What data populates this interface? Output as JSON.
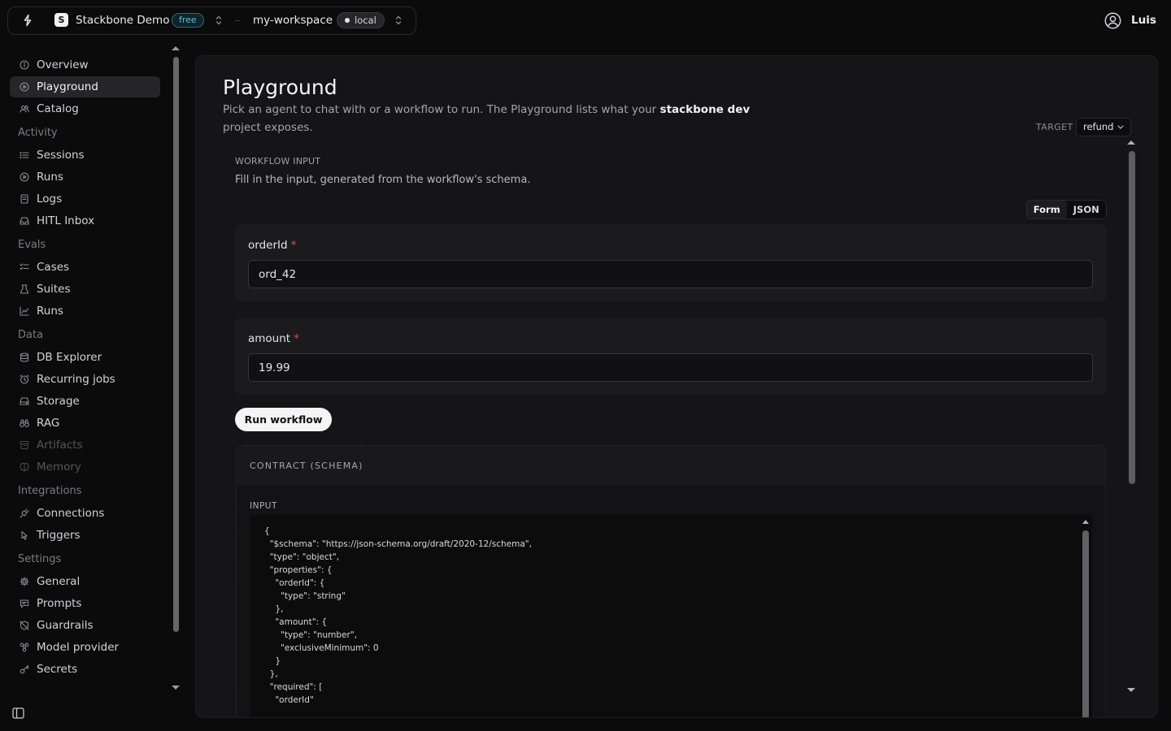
{
  "topbar": {
    "project_initial": "S",
    "project_name": "Stackbone Demo",
    "plan_badge": "free",
    "workspace_name": "my-workspace",
    "env_badge": "local",
    "user_name": "Luis"
  },
  "sidebar": {
    "top_items": [
      {
        "label": "Overview",
        "icon": "info-icon",
        "active": false
      },
      {
        "label": "Playground",
        "icon": "play-circle-icon",
        "active": true
      },
      {
        "label": "Catalog",
        "icon": "users-icon",
        "active": false
      }
    ],
    "sections": [
      {
        "title": "Activity",
        "items": [
          {
            "label": "Sessions",
            "icon": "list-icon"
          },
          {
            "label": "Runs",
            "icon": "play-circle-icon"
          },
          {
            "label": "Logs",
            "icon": "document-icon"
          },
          {
            "label": "HITL Inbox",
            "icon": "inbox-icon"
          }
        ]
      },
      {
        "title": "Evals",
        "items": [
          {
            "label": "Cases",
            "icon": "checklist-icon"
          },
          {
            "label": "Suites",
            "icon": "beaker-icon"
          },
          {
            "label": "Runs",
            "icon": "chart-icon"
          }
        ]
      },
      {
        "title": "Data",
        "items": [
          {
            "label": "DB Explorer",
            "icon": "database-icon"
          },
          {
            "label": "Recurring jobs",
            "icon": "clock-icon"
          },
          {
            "label": "Storage",
            "icon": "hard-drive-icon"
          },
          {
            "label": "RAG",
            "icon": "binoculars-icon"
          },
          {
            "label": "Artifacts",
            "icon": "archive-icon",
            "disabled": true
          },
          {
            "label": "Memory",
            "icon": "brain-icon",
            "disabled": true
          }
        ]
      },
      {
        "title": "Integrations",
        "items": [
          {
            "label": "Connections",
            "icon": "plug-icon"
          },
          {
            "label": "Triggers",
            "icon": "pointer-icon"
          }
        ]
      },
      {
        "title": "Settings",
        "items": [
          {
            "label": "General",
            "icon": "gear-icon"
          },
          {
            "label": "Prompts",
            "icon": "message-icon"
          },
          {
            "label": "Guardrails",
            "icon": "shield-off-icon"
          },
          {
            "label": "Model provider",
            "icon": "cpu-icon"
          },
          {
            "label": "Secrets",
            "icon": "key-icon"
          }
        ]
      }
    ]
  },
  "main": {
    "title": "Playground",
    "desc_prefix": "Pick an agent to chat with or a workflow to run. The Playground lists what your",
    "desc_project": "stackbone dev",
    "desc_suffix": "project exposes.",
    "target_label": "TARGET",
    "target_value": "refund",
    "workflow_label": "WORKFLOW INPUT",
    "workflow_desc": "Fill in the input, generated from the workflow's schema.",
    "mode_form": "Form",
    "mode_json": "JSON",
    "fields": [
      {
        "label": "orderId",
        "required_mark": "*",
        "value": "ord_42"
      },
      {
        "label": "amount",
        "required_mark": "*",
        "value": "19.99"
      }
    ],
    "run_button": "Run workflow",
    "contract_title": "CONTRACT (SCHEMA)",
    "contract_input_label": "INPUT",
    "schema_code": "{\n  \"$schema\": \"https://json-schema.org/draft/2020-12/schema\",\n  \"type\": \"object\",\n  \"properties\": {\n    \"orderId\": {\n      \"type\": \"string\"\n    },\n    \"amount\": {\n      \"type\": \"number\",\n      \"exclusiveMinimum\": 0\n    }\n  },\n  \"required\": [\n    \"orderId\""
  }
}
